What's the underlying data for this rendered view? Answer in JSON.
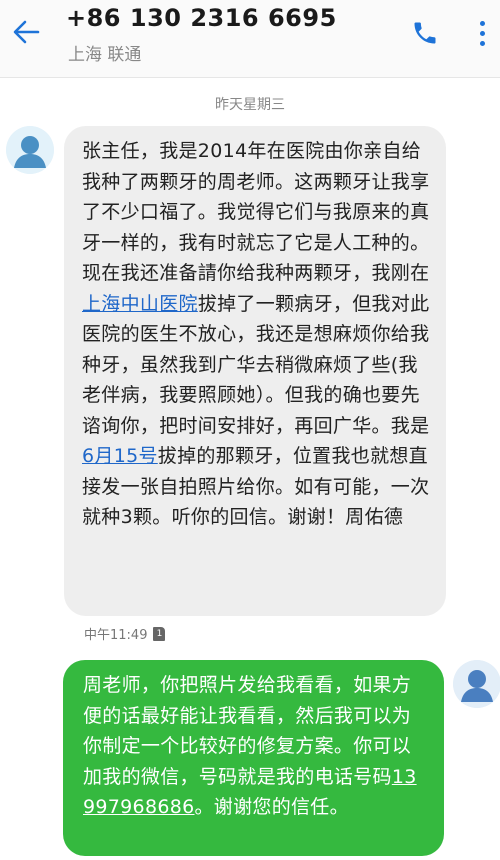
{
  "header": {
    "back_icon": "arrow-left-icon",
    "contact_number": "+86 130 2316 6695",
    "carrier": "上海 联通",
    "call_icon": "phone-icon",
    "more_icon": "more-vertical-icon",
    "accent_color": "#1e73d8"
  },
  "conversation": {
    "date_separator": "昨天星期三",
    "incoming": {
      "avatar_icon": "person-avatar-icon",
      "bubble_color": "#eeeeee",
      "text_part1": "张主任，我是2014年在医院由你亲自给我种了两颗牙的周老师。这两颗牙让我享了不少口福了。我觉得它们与我原来的真牙一样的，我有时就忘了它是人工种的。现在我还准备請你给我种两颗牙，我刚在",
      "link_hospital": "上海中山医院",
      "text_part2": "拔掉了一颗病牙，但我对此医院的医生不放心，我还是想麻烦你给我种牙，虽然我到广华去稍微麻烦了些(我老伴病，我要照顾她）。但我的确也要先谘询你，把时间安排好，再回广华。我是",
      "link_date": "6月15号",
      "text_part3": "拔掉的那颗牙，位置我也就想直接发一张自拍照片给你。如有可能，一次就种3颗。听你的回信。谢谢！周佑德",
      "time": "中午11:49",
      "sim_label": "1"
    },
    "outgoing": {
      "avatar_icon": "person-avatar-icon",
      "bubble_color": "#35b93f",
      "text_part1": "周老师，你把照片发给我看看，如果方便的话最好能让我看看，然后我可以为你制定一个比较好的修复方案。你可以加我的微信，号码就是我的电话号码",
      "link_phone": "13997968686",
      "text_part2": "。谢谢您的信任。"
    }
  }
}
